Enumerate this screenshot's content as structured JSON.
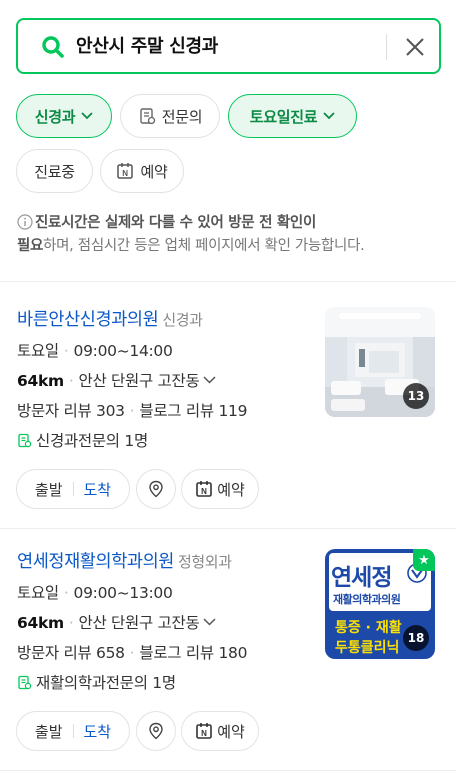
{
  "search": {
    "query": "안산시 주말 신경과",
    "icon": "search-icon",
    "clear_icon": "close-icon"
  },
  "filters": {
    "chips": [
      {
        "label": "신경과",
        "active": true,
        "dropdown": true
      },
      {
        "label": "전문의",
        "active": false,
        "icon": "specialist-icon"
      },
      {
        "label": "토요일진료",
        "active": true,
        "dropdown": true
      },
      {
        "label": "진료중",
        "active": false
      },
      {
        "label": "예약",
        "active": false,
        "icon": "naver-reserve-icon"
      }
    ]
  },
  "notice": {
    "bold_part": "진료시간은 실제와 다를 수 있어 방문 전 확인이 필요",
    "bold_line1": "진료시간은 실제와 다를 수 있어 방문 전 확인이",
    "bold_line2": "필요",
    "rest": "하며, 점심시간 등은 업체 페이지에서 확인 가능합니다."
  },
  "places": [
    {
      "name": "바른안산신경과의원",
      "category": "신경과",
      "day": "토요일",
      "hours": "09:00~14:00",
      "distance": "64km",
      "address": "안산 단원구 고잔동",
      "visitor_reviews": "방문자 리뷰 303",
      "blog_reviews": "블로그 리뷰 119",
      "specialist": "신경과전문의 1명",
      "photo_count": "13",
      "buttons": {
        "depart": "출발",
        "arrive": "도착",
        "reserve": "예약"
      }
    },
    {
      "name": "연세정재활의학과의원",
      "category": "정형외과",
      "day": "토요일",
      "hours": "09:00~13:00",
      "distance": "64km",
      "address": "안산 단원구 고잔동",
      "visitor_reviews": "방문자 리뷰 658",
      "blog_reviews": "블로그 리뷰 180",
      "specialist": "재활의학과전문의 1명",
      "photo_count": "18",
      "thumb_text": {
        "line1": "연세정",
        "line2": "재활의학과의원",
        "line3": "통증 · 재활",
        "line4": "두통클리닉"
      },
      "buttons": {
        "depart": "출발",
        "arrive": "도착",
        "reserve": "예약"
      }
    }
  ],
  "colors": {
    "accent": "#03c75a",
    "link": "#0b58c8",
    "thumb_blue": "#1d4aa8",
    "thumb_yellow": "#ffe100"
  }
}
